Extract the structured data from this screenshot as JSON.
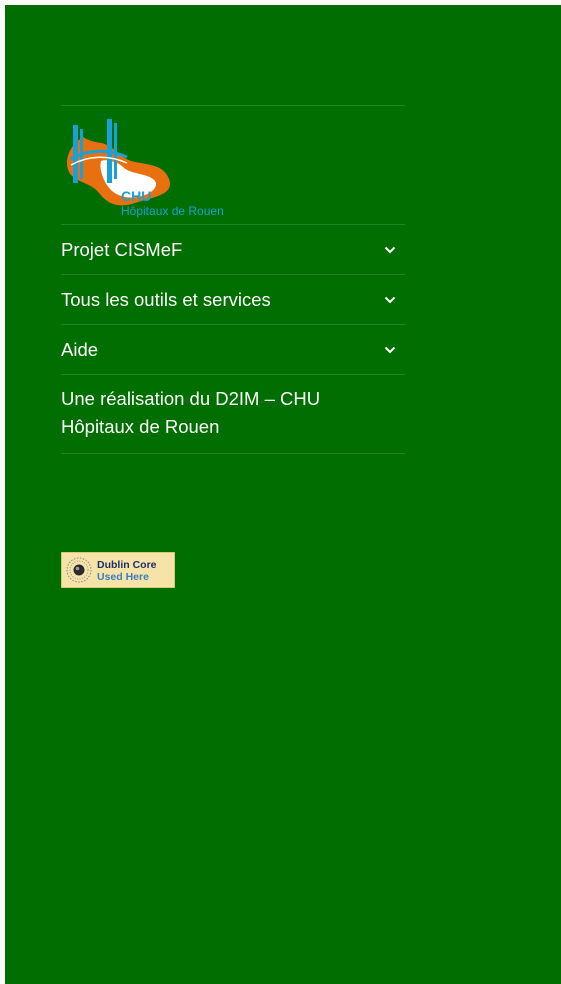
{
  "logo": {
    "chu_text": "CHU",
    "sub_text": "Hôpitaux de Rouen"
  },
  "menu": {
    "items": [
      {
        "label": "Projet CISMeF",
        "icon": "chevron-down-icon"
      },
      {
        "label": "Tous les outils et services",
        "icon": "chevron-down-icon"
      },
      {
        "label": "Aide",
        "icon": "chevron-down-icon"
      }
    ],
    "credit_line1": "Une réalisation du D2IM – CHU",
    "credit_line2": "Hôpitaux de Rouen"
  },
  "badge": {
    "line1": "Dublin Core",
    "line2": "Used Here"
  },
  "colors": {
    "background": "#006e00",
    "text": "#ffffff",
    "logo_orange": "#e8700f",
    "logo_blue": "#1aa0d8"
  }
}
